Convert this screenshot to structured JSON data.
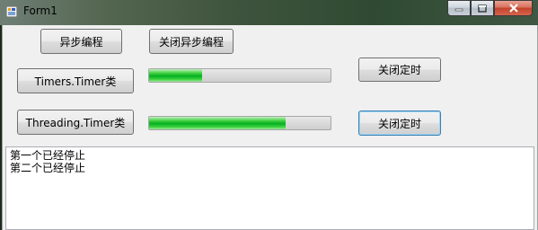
{
  "window": {
    "title": "Form1"
  },
  "buttons": {
    "async": "异步编程",
    "close_async": "关闭异步编程",
    "timers": "Timers.Timer类",
    "threading": "Threading.Timer类",
    "close_timer_1": "关闭定时",
    "close_timer_2": "关闭定时"
  },
  "progress": {
    "timers_fraction": 0.29,
    "threading_fraction": 0.75
  },
  "output": {
    "lines": [
      "第一个已经停止",
      "第二个已经停止"
    ]
  },
  "colors": {
    "progress_green": "#06b025",
    "close_red": "#c2422a"
  }
}
